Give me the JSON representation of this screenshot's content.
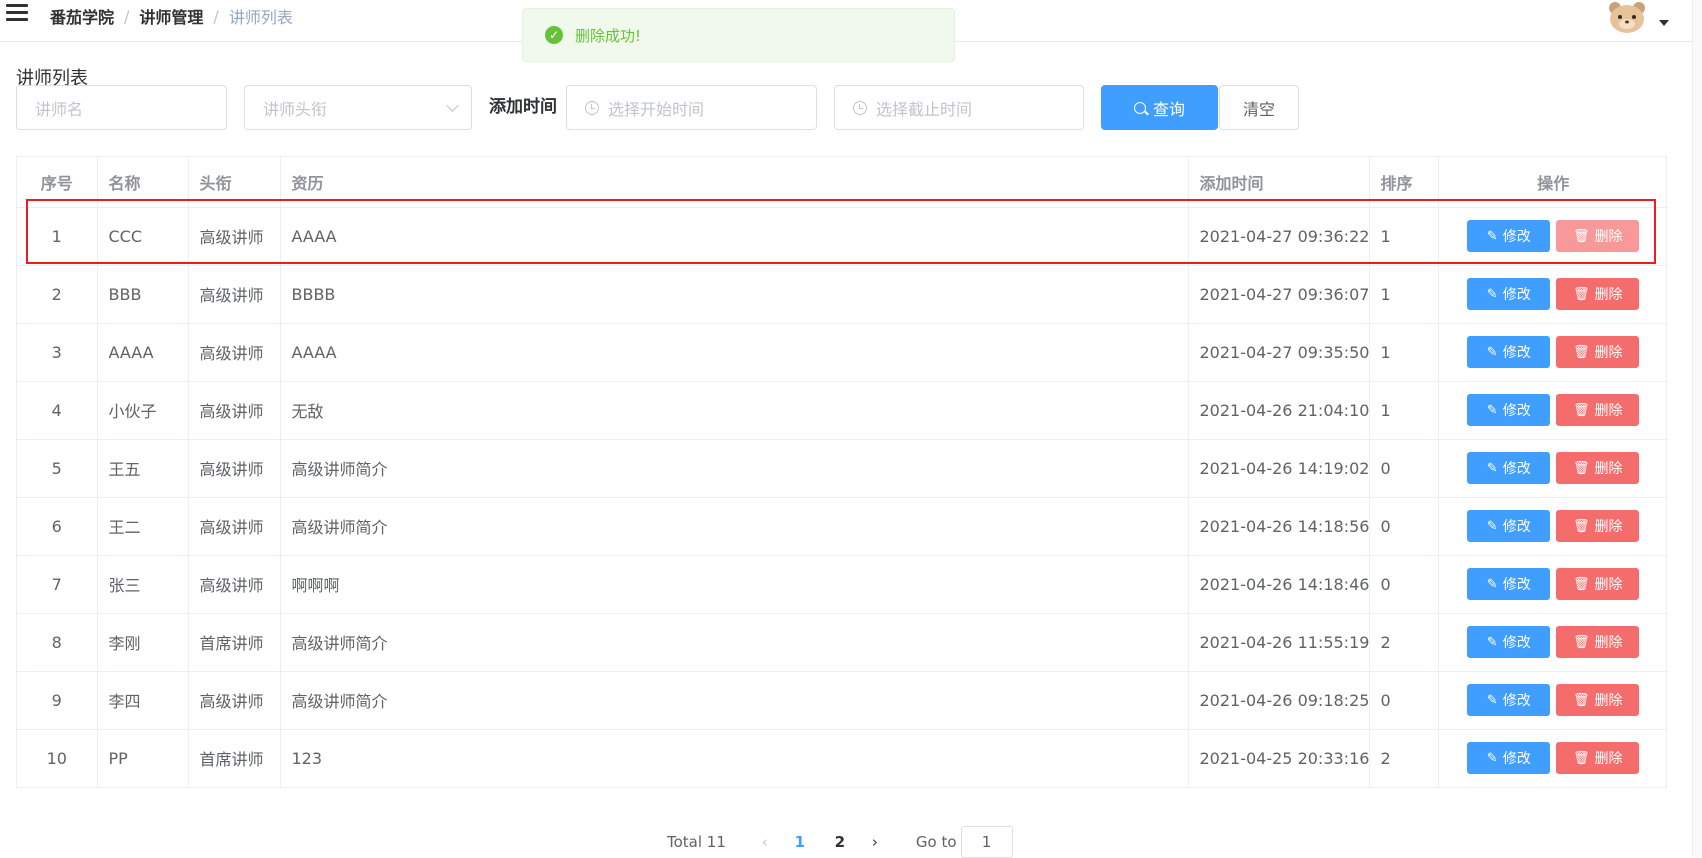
{
  "breadcrumb": [
    "番茄学院",
    "讲师管理",
    "讲师列表"
  ],
  "toast": {
    "message": "删除成功!"
  },
  "page_title": "讲师列表",
  "search": {
    "name_placeholder": "讲师名",
    "level_placeholder": "讲师头衔",
    "time_label": "添加时间",
    "start_placeholder": "选择开始时间",
    "end_placeholder": "选择截止时间",
    "query_label": "查询",
    "clear_label": "清空"
  },
  "table": {
    "headers": [
      "序号",
      "名称",
      "头衔",
      "资历",
      "添加时间",
      "排序",
      "操作"
    ],
    "edit_label": "修改",
    "delete_label": "删除",
    "rows": [
      {
        "no": "1",
        "name": "CCC",
        "level": "高级讲师",
        "intro": "AAAA",
        "time": "2021-04-27 09:36:22",
        "sort": "1"
      },
      {
        "no": "2",
        "name": "BBB",
        "level": "高级讲师",
        "intro": "BBBB",
        "time": "2021-04-27 09:36:07",
        "sort": "1"
      },
      {
        "no": "3",
        "name": "AAAA",
        "level": "高级讲师",
        "intro": "AAAA",
        "time": "2021-04-27 09:35:50",
        "sort": "1"
      },
      {
        "no": "4",
        "name": "小伙子",
        "level": "高级讲师",
        "intro": "无敌",
        "time": "2021-04-26 21:04:10",
        "sort": "1"
      },
      {
        "no": "5",
        "name": "王五",
        "level": "高级讲师",
        "intro": "高级讲师简介",
        "time": "2021-04-26 14:19:02",
        "sort": "0"
      },
      {
        "no": "6",
        "name": "王二",
        "level": "高级讲师",
        "intro": "高级讲师简介",
        "time": "2021-04-26 14:18:56",
        "sort": "0"
      },
      {
        "no": "7",
        "name": "张三",
        "level": "高级讲师",
        "intro": "啊啊啊",
        "time": "2021-04-26 14:18:46",
        "sort": "0"
      },
      {
        "no": "8",
        "name": "李刚",
        "level": "首席讲师",
        "intro": "高级讲师简介",
        "time": "2021-04-26 11:55:19",
        "sort": "2"
      },
      {
        "no": "9",
        "name": "李四",
        "level": "高级讲师",
        "intro": "高级讲师简介",
        "time": "2021-04-26 09:18:25",
        "sort": "0"
      },
      {
        "no": "10",
        "name": "PP",
        "level": "首席讲师",
        "intro": "123",
        "time": "2021-04-25 20:33:16",
        "sort": "2"
      }
    ]
  },
  "pagination": {
    "total_label": "Total 11",
    "pages": [
      "1",
      "2"
    ],
    "current": "1",
    "goto_label": "Go to",
    "goto_value": "1"
  },
  "colors": {
    "primary": "#409eff",
    "danger": "#f56c6c",
    "success": "#67c23a",
    "highlight": "#e51f24"
  }
}
